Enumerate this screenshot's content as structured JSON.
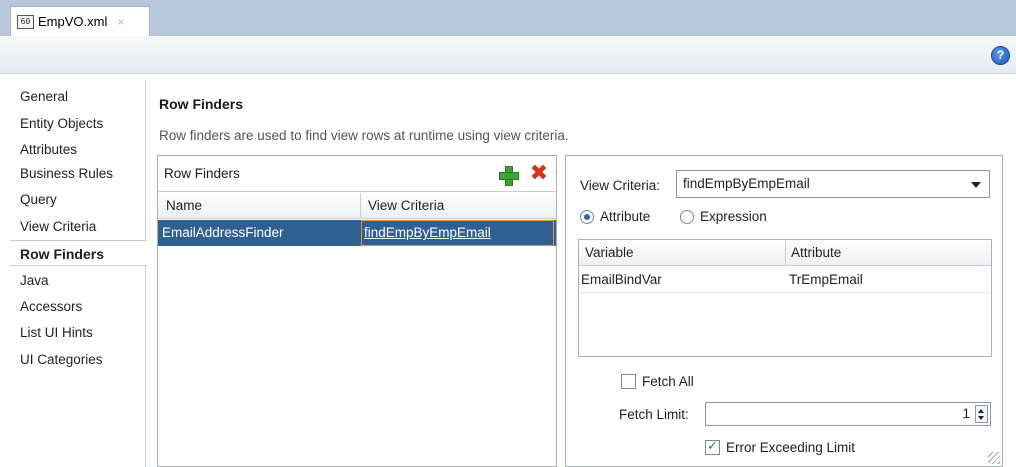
{
  "tab": {
    "title": "EmpVO.xml",
    "close": "×",
    "icon_label": "60"
  },
  "toolbar": {
    "help_icon": "?"
  },
  "sidebar": {
    "items": [
      {
        "label": "General"
      },
      {
        "label": "Entity Objects"
      },
      {
        "label": "Attributes"
      },
      {
        "label": "Business Rules"
      },
      {
        "label": "Query"
      },
      {
        "label": "View Criteria"
      },
      {
        "label": "Row Finders",
        "active": true
      },
      {
        "label": "Java"
      },
      {
        "label": "Accessors"
      },
      {
        "label": "List UI Hints"
      },
      {
        "label": "UI Categories"
      }
    ]
  },
  "main": {
    "title": "Row Finders",
    "description": "Row finders are used to find view rows at runtime using view criteria."
  },
  "finders": {
    "panel_title": "Row Finders",
    "delete_glyph": "✖",
    "columns": [
      "Name",
      "View Criteria"
    ],
    "rows": [
      {
        "name": "EmailAddressFinder",
        "view_criteria": "findEmpByEmpEmail",
        "selected": true
      }
    ]
  },
  "details": {
    "view_criteria_label": "View Criteria:",
    "view_criteria_value": "findEmpByEmpEmail",
    "mode_options": [
      {
        "label": "Attribute",
        "selected": true
      },
      {
        "label": "Expression",
        "selected": false
      }
    ],
    "columns": [
      "Variable",
      "Attribute"
    ],
    "rows": [
      {
        "variable": "EmailBindVar",
        "attribute": "TrEmpEmail"
      }
    ],
    "fetch_all_label": "Fetch All",
    "fetch_all_checked": false,
    "fetch_limit_label": "Fetch Limit:",
    "fetch_limit_value": "1",
    "error_limit_label": "Error Exceeding Limit",
    "error_limit_checked": true
  },
  "colors": {
    "tabbar": "#b8c7da",
    "selection": "#2f5f93",
    "add_green": "#3fa335",
    "delete_red": "#d5311b",
    "focus_outline": "#e29a2a"
  }
}
